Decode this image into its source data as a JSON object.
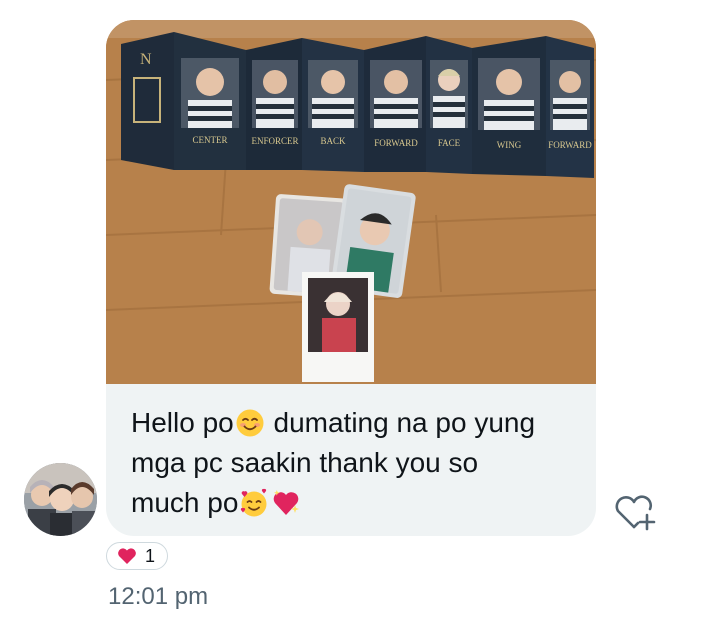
{
  "message": {
    "line1_a": "Hello po",
    "line1_b": " dumating na po yung",
    "line2": "mga pc saakin thank you so",
    "line3": "much po"
  },
  "emojis": [
    "smiling-face-with-smiling-eyes-icon",
    "smiling-face-with-hearts-icon",
    "sparkling-heart-icon"
  ],
  "photo_card_labels": [
    "CENTER",
    "ENFORCER",
    "BACK",
    "FORWARD",
    "FACE",
    "WING",
    "FORWARD"
  ],
  "reaction": {
    "emoji": "heart-icon",
    "count": "1"
  },
  "timestamp": "12:01 pm",
  "colors": {
    "bubble": "#eff3f4",
    "text": "#0f1419",
    "muted": "#536471",
    "heart": "#e0245e"
  }
}
